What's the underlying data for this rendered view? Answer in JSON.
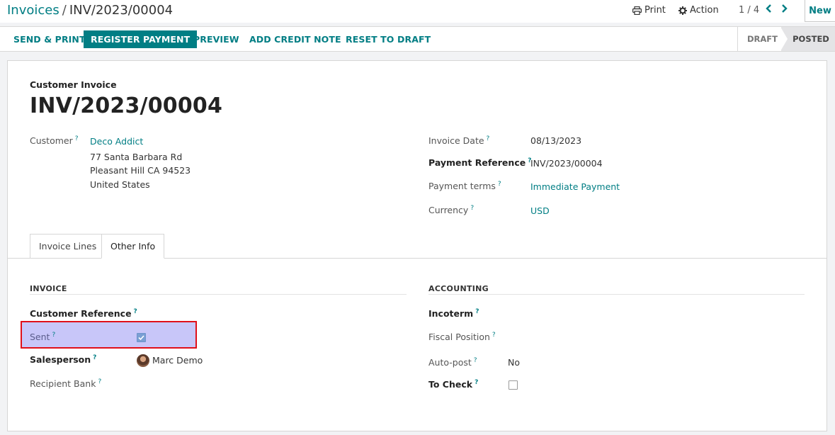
{
  "breadcrumb": {
    "parent": "Invoices",
    "separator": "/",
    "current": "INV/2023/00004"
  },
  "toolbar": {
    "print_label": "Print",
    "action_label": "Action",
    "pager": "1 / 4",
    "new_label": "New"
  },
  "statusbar": {
    "actions": [
      "SEND & PRINT",
      "REGISTER PAYMENT",
      "PREVIEW",
      "ADD CREDIT NOTE",
      "RESET TO DRAFT"
    ],
    "states": [
      "DRAFT",
      "POSTED"
    ],
    "current_state": "POSTED"
  },
  "header": {
    "kind": "Customer Invoice",
    "title": "INV/2023/00004"
  },
  "left_fields": {
    "customer_label": "Customer",
    "customer_name": "Deco Addict",
    "address_line1": "77 Santa Barbara Rd",
    "address_line2": "Pleasant Hill CA 94523",
    "address_line3": "United States"
  },
  "right_fields": {
    "invoice_date_label": "Invoice Date",
    "invoice_date": "08/13/2023",
    "payment_reference_label": "Payment Reference",
    "payment_reference": "INV/2023/00004",
    "payment_terms_label": "Payment terms",
    "payment_terms": "Immediate Payment",
    "currency_label": "Currency",
    "currency": "USD"
  },
  "tabs": [
    {
      "label": "Invoice Lines",
      "active": false
    },
    {
      "label": "Other Info",
      "active": true
    }
  ],
  "other_info": {
    "invoice_group": "INVOICE",
    "customer_reference_label": "Customer Reference",
    "sent_label": "Sent",
    "sent_checked": true,
    "salesperson_label": "Salesperson",
    "salesperson": "Marc Demo",
    "recipient_bank_label": "Recipient Bank",
    "accounting_group": "ACCOUNTING",
    "incoterm_label": "Incoterm",
    "fiscal_position_label": "Fiscal Position",
    "auto_post_label": "Auto-post",
    "auto_post": "No",
    "to_check_label": "To Check",
    "to_check_checked": false
  },
  "help_marker": "?",
  "colors": {
    "brand": "#017e84",
    "highlight_fill": "#c8c6f9",
    "highlight_border": "#e0101a"
  },
  "icons": {
    "print": "printer-icon",
    "action": "gear-icon",
    "prev": "chevron-left-icon",
    "next": "chevron-right-icon"
  }
}
